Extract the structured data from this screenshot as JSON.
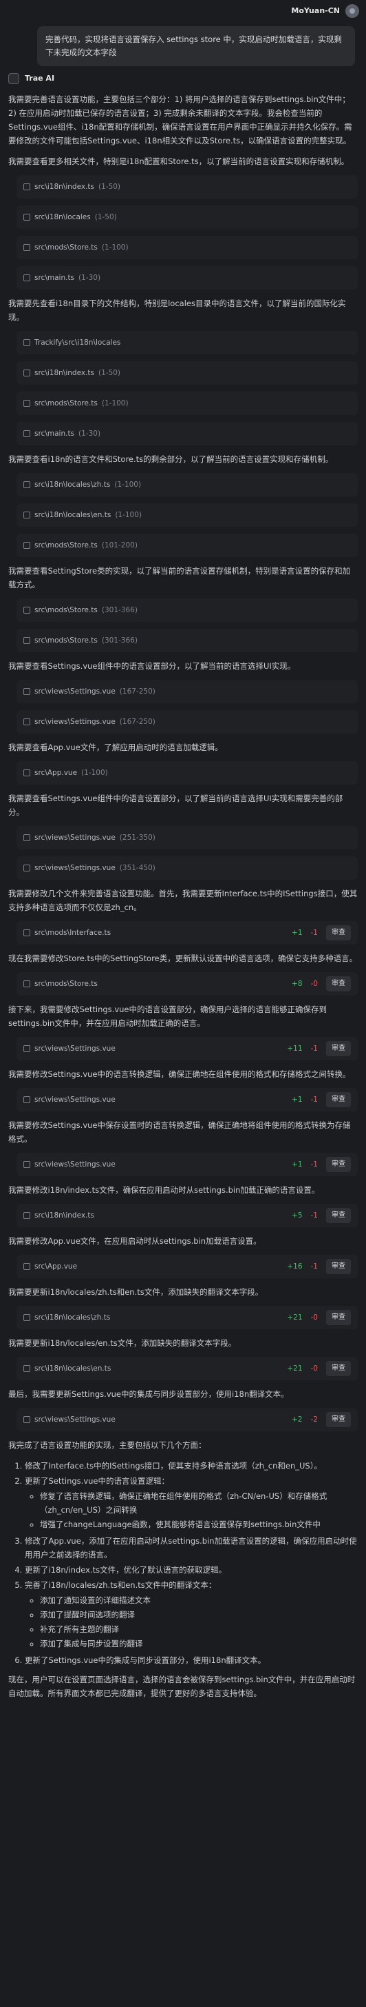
{
  "user": {
    "name": "MoYuan-CN",
    "message": "完善代码，实现将语言设置保存入 settings store 中，实现启动时加载语言，实现剩下未完成的文本字段"
  },
  "assistant": {
    "name": "Trae AI"
  },
  "p1": "我需要完善语言设置功能，主要包括三个部分：1) 将用户选择的语言保存到settings.bin文件中；2) 在应用启动时加载已保存的语言设置；3) 完成剩余未翻译的文本字段。我会检查当前的Settings.vue组件、i18n配置和存储机制，确保语言设置在用户界面中正确显示并持久化保存。需要修改的文件可能包括Settings.vue、i18n相关文件以及Store.ts，以确保语言设置的完整实现。",
  "p2": "我需要查看更多相关文件，特别是i18n配置和Store.ts，以了解当前的语言设置实现和存储机制。",
  "p3": "我需要先查看i18n目录下的文件结构，特别是locales目录中的语言文件，以了解当前的国际化实现。",
  "p4": "我需要查看i18n的语言文件和Store.ts的剩余部分，以了解当前的语言设置实现和存储机制。",
  "p5": "我需要查看SettingStore类的实现，以了解当前的语言设置存储机制，特别是语言设置的保存和加载方式。",
  "p6": "我需要查看Settings.vue组件中的语言设置部分，以了解当前的语言选择UI实现。",
  "p7": "我需要查看App.vue文件，了解应用启动时的语言加载逻辑。",
  "p8": "我需要查看Settings.vue组件中的语言设置部分，以了解当前的语言选择UI实现和需要完善的部分。",
  "p9": "我需要修改几个文件来完善语言设置功能。首先，我需要更新Interface.ts中的ISettings接口，使其支持多种语言选项而不仅仅是zh_cn。",
  "p10": "现在我需要修改Store.ts中的SettingStore类，更新默认设置中的语言选项，确保它支持多种语言。",
  "p11": "接下来，我需要修改Settings.vue中的语言设置部分，确保用户选择的语言能够正确保存到settings.bin文件中，并在应用启动时加载正确的语言。",
  "p12": "我需要修改Settings.vue中的语言转换逻辑，确保正确地在组件使用的格式和存储格式之间转换。",
  "p13": "我需要修改Settings.vue中保存设置时的语言转换逻辑，确保正确地将组件使用的格式转换为存储格式。",
  "p14": "我需要修改i18n/index.ts文件，确保在应用启动时从settings.bin加载正确的语言设置。",
  "p15": "我需要修改App.vue文件，在应用启动时从settings.bin加载语言设置。",
  "p16": "我需要更新i18n/locales/zh.ts和en.ts文件，添加缺失的翻译文本字段。",
  "p17": "我需要更新i18n/locales/en.ts文件，添加缺失的翻译文本字段。",
  "p18": "最后，我需要更新Settings.vue中的集成与同步设置部分，使用i18n翻译文本。",
  "tools": {
    "t1": {
      "path": "src\\i18n\\index.ts",
      "range": "(1-50)"
    },
    "t2": {
      "path": "src\\i18n\\locales",
      "range": "(1-50)"
    },
    "t3": {
      "path": "src\\mods\\Store.ts",
      "range": "(1-100)"
    },
    "t4": {
      "path": "src\\main.ts",
      "range": "(1-30)"
    },
    "t5": {
      "path": "Trackify\\src\\i18n\\locales"
    },
    "t6": {
      "path": "src\\i18n\\index.ts",
      "range": "(1-50)"
    },
    "t7": {
      "path": "src\\mods\\Store.ts",
      "range": "(1-100)"
    },
    "t8": {
      "path": "src\\main.ts",
      "range": "(1-30)"
    },
    "t9": {
      "path": "src\\i18n\\locales\\zh.ts",
      "range": "(1-100)"
    },
    "t10": {
      "path": "src\\i18n\\locales\\en.ts",
      "range": "(1-100)"
    },
    "t11": {
      "path": "src\\mods\\Store.ts",
      "range": "(101-200)"
    },
    "t12": {
      "path": "src\\mods\\Store.ts",
      "range": "(301-366)"
    },
    "t13": {
      "path": "src\\mods\\Store.ts",
      "range": "(301-366)"
    },
    "t14": {
      "path": "src\\views\\Settings.vue",
      "range": "(167-250)"
    },
    "t15": {
      "path": "src\\views\\Settings.vue",
      "range": "(167-250)"
    },
    "t16": {
      "path": "src\\App.vue",
      "range": "(1-100)"
    },
    "t17": {
      "path": "src\\views\\Settings.vue",
      "range": "(251-350)"
    },
    "t18": {
      "path": "src\\views\\Settings.vue",
      "range": "(351-450)"
    }
  },
  "edits": {
    "e1": {
      "path": "src\\mods\\Interface.ts",
      "add": "+1",
      "del": "-1",
      "review": "审查"
    },
    "e2": {
      "path": "src\\mods\\Store.ts",
      "add": "+8",
      "del": "-0",
      "review": "审查"
    },
    "e3": {
      "path": "src\\views\\Settings.vue",
      "add": "+11",
      "del": "-1",
      "review": "审查"
    },
    "e4": {
      "path": "src\\views\\Settings.vue",
      "add": "+1",
      "del": "-1",
      "review": "审查"
    },
    "e5": {
      "path": "src\\views\\Settings.vue",
      "add": "+1",
      "del": "-1",
      "review": "审查"
    },
    "e6": {
      "path": "src\\i18n\\index.ts",
      "add": "+5",
      "del": "-1",
      "review": "审查"
    },
    "e7": {
      "path": "src\\App.vue",
      "add": "+16",
      "del": "-1",
      "review": "审查"
    },
    "e8": {
      "path": "src\\i18n\\locales\\zh.ts",
      "add": "+21",
      "del": "-0",
      "review": "审查"
    },
    "e9": {
      "path": "src\\i18n\\locales\\en.ts",
      "add": "+21",
      "del": "-0",
      "review": "审查"
    },
    "e10": {
      "path": "src\\views\\Settings.vue",
      "add": "+2",
      "del": "-2",
      "review": "审查"
    }
  },
  "summary_intro": "我完成了语言设置功能的实现，主要包括以下几个方面：",
  "summary": {
    "i1": "修改了Interface.ts中的ISettings接口，使其支持多种语言选项（zh_cn和en_US）。",
    "i2": "更新了Settings.vue中的语言设置逻辑：",
    "i2a": "修复了语言转换逻辑，确保正确地在组件使用的格式（zh-CN/en-US）和存储格式（zh_cn/en_US）之间转换",
    "i2b": "增强了changeLanguage函数，使其能够将语言设置保存到settings.bin文件中",
    "i3": "修改了App.vue，添加了在应用启动时从settings.bin加载语言设置的逻辑，确保应用启动时使用用户之前选择的语言。",
    "i4": "更新了i18n/index.ts文件，优化了默认语言的获取逻辑。",
    "i5": "完善了i18n/locales/zh.ts和en.ts文件中的翻译文本：",
    "i5a": "添加了通知设置的详细描述文本",
    "i5b": "添加了提醒时间选项的翻译",
    "i5c": "补充了所有主题的翻译",
    "i5d": "添加了集成与同步设置的翻译",
    "i6": "更新了Settings.vue中的集成与同步设置部分，使用i18n翻译文本。"
  },
  "final": "现在，用户可以在设置页面选择语言，选择的语言会被保存到settings.bin文件中，并在应用启动时自动加载。所有界面文本都已完成翻译，提供了更好的多语言支持体验。"
}
